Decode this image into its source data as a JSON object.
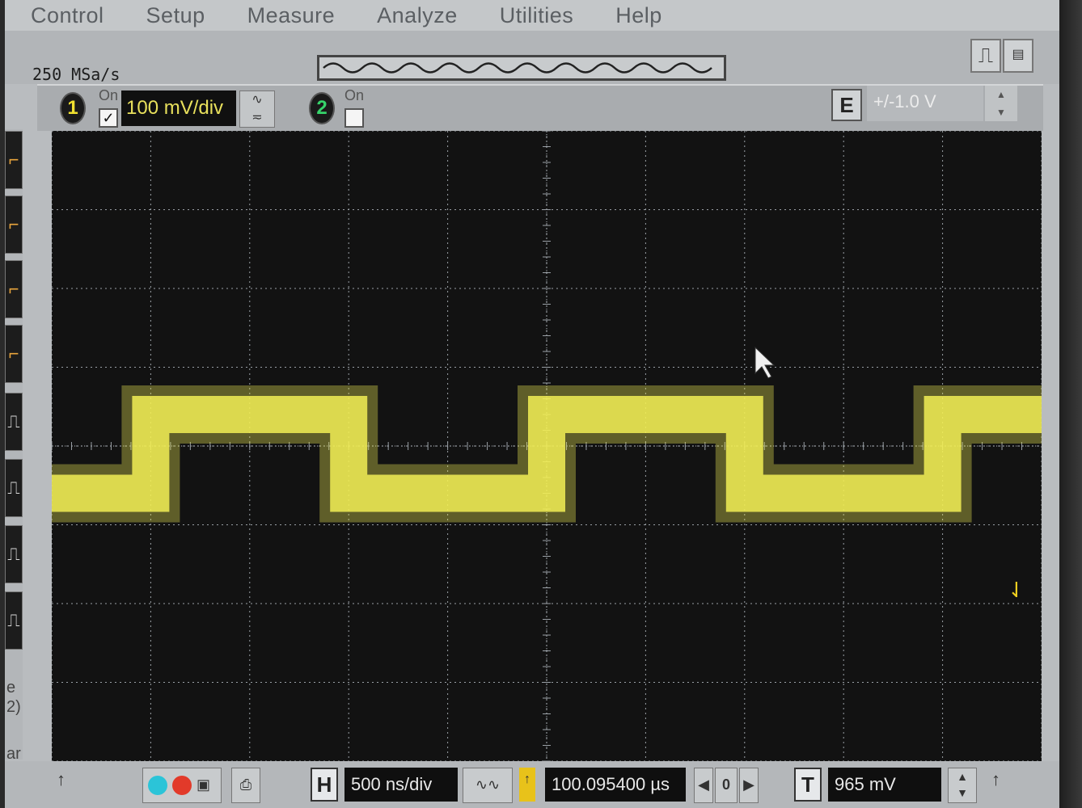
{
  "menu": [
    "Control",
    "Setup",
    "Measure",
    "Analyze",
    "Utilities",
    "Help"
  ],
  "acquisition": {
    "sample_rate": "250 MSa/s"
  },
  "channel1": {
    "number": "1",
    "on_label": "On",
    "checked_mark": "✓",
    "scale": "100 mV/div",
    "color": "#f0e030"
  },
  "channel2": {
    "number": "2",
    "on_label": "On",
    "color": "#36d36a"
  },
  "external": {
    "label": "E",
    "range": "+/-1.0 V"
  },
  "side_labels": {
    "label_a": "e",
    "label_b": "2)",
    "label_c": "ar"
  },
  "bottom": {
    "up_arrow": "↑",
    "h_label": "H",
    "timebase": "500 ns/div",
    "delay": "100.095400 µs",
    "delay_ref": "0",
    "t_label": "T",
    "trigger_level": "965 mV"
  },
  "colors": {
    "trace": "#f2ef55",
    "grid": "#9aa0a6",
    "screen_bg": "#121212"
  },
  "chart_data": {
    "type": "line",
    "title": "",
    "xlabel": "",
    "ylabel": "",
    "grid": true,
    "x_divisions": 10,
    "y_divisions": 8,
    "series": [
      {
        "x": [
          0,
          1,
          1,
          3,
          3,
          5,
          5,
          7,
          7,
          9,
          9,
          10
        ],
        "y": [
          -0.6,
          -0.6,
          0.4,
          0.4,
          -0.6,
          -0.6,
          0.4,
          0.4,
          -0.6,
          -0.6,
          0.4,
          0.4
        ]
      }
    ]
  }
}
